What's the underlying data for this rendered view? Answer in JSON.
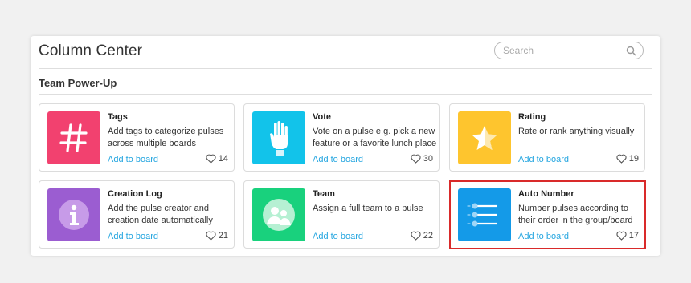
{
  "header": {
    "title": "Column Center",
    "search_placeholder": "Search"
  },
  "section": {
    "title": "Team Power-Up"
  },
  "cards": [
    {
      "name": "Tags",
      "desc": "Add tags to categorize pulses across multiple boards",
      "action": "Add to board",
      "likes": "14",
      "color": "#f2416f",
      "icon": "hashtag-icon"
    },
    {
      "name": "Vote",
      "desc": "Vote on a pulse e.g. pick a new feature or a favorite lunch place",
      "action": "Add to board",
      "likes": "30",
      "color": "#12c3ea",
      "icon": "raised-hand-icon"
    },
    {
      "name": "Rating",
      "desc": "Rate or rank anything visually",
      "action": "Add to board",
      "likes": "19",
      "color": "#fec52e",
      "icon": "star-icon"
    },
    {
      "name": "Creation Log",
      "desc": "Add the pulse creator and creation date automatically",
      "action": "Add to board",
      "likes": "21",
      "color": "#9b5dd1",
      "icon": "info-icon"
    },
    {
      "name": "Team",
      "desc": "Assign a full team to a pulse",
      "action": "Add to board",
      "likes": "22",
      "color": "#19d17d",
      "icon": "team-icon"
    },
    {
      "name": "Auto Number",
      "desc": "Number pulses according to their order in the group/board",
      "action": "Add to board",
      "likes": "17",
      "color": "#149ae8",
      "icon": "numbered-list-icon"
    }
  ]
}
